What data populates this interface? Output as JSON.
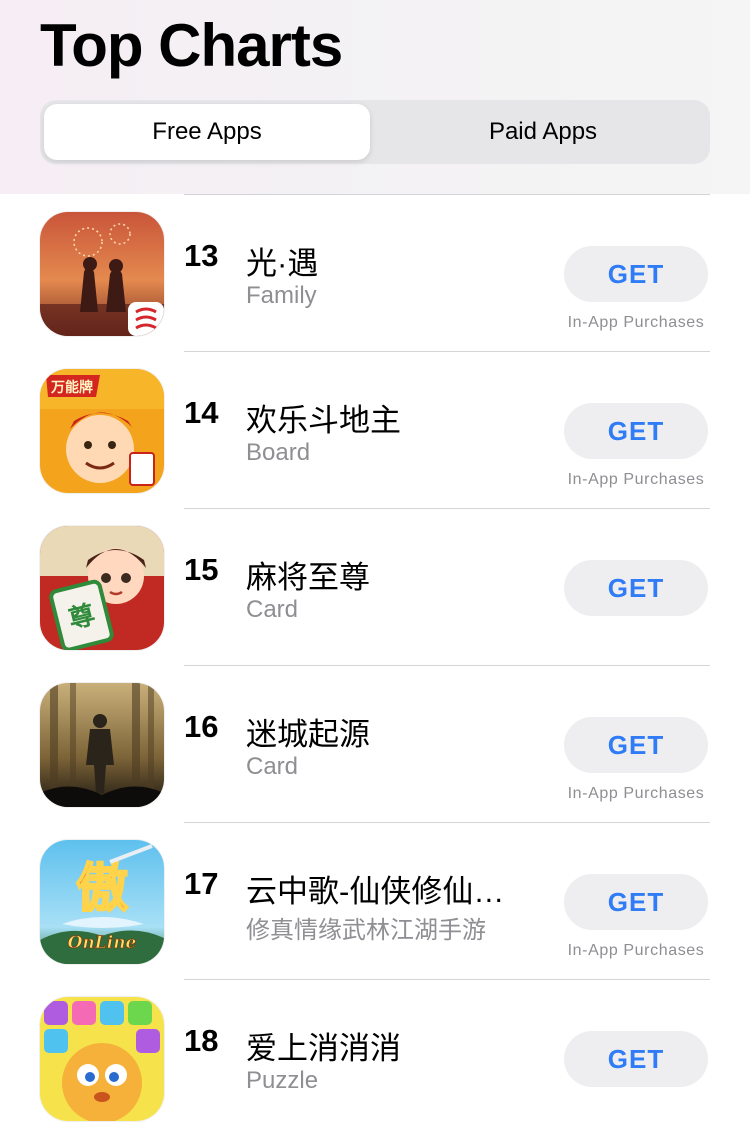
{
  "header": {
    "title": "Top Charts",
    "tabs": [
      {
        "label": "Free Apps",
        "selected": true
      },
      {
        "label": "Paid Apps",
        "selected": false
      }
    ]
  },
  "colors": {
    "accent": "#2f7cf6",
    "secondary_text": "#8e8e93",
    "button_bg": "#eeeef0"
  },
  "apps": [
    {
      "rank": "13",
      "name": "光·遇",
      "category": "Family",
      "button": "GET",
      "note": "In-App Purchases",
      "icon": "sky-children-of-light-icon"
    },
    {
      "rank": "14",
      "name": "欢乐斗地主",
      "category": "Board",
      "button": "GET",
      "note": "In-App Purchases",
      "icon": "happy-landlord-icon"
    },
    {
      "rank": "15",
      "name": "麻将至尊",
      "category": "Card",
      "button": "GET",
      "note": "",
      "icon": "mahjong-supreme-icon"
    },
    {
      "rank": "16",
      "name": "迷城起源",
      "category": "Card",
      "button": "GET",
      "note": "In-App Purchases",
      "icon": "lost-city-origin-icon"
    },
    {
      "rank": "17",
      "name": "云中歌-仙侠修仙…",
      "category": "修真情缘武林江湖手游",
      "button": "GET",
      "note": "In-App Purchases",
      "icon": "yunzhongge-online-icon"
    },
    {
      "rank": "18",
      "name": "爱上消消消",
      "category": "Puzzle",
      "button": "GET",
      "note": "",
      "icon": "love-match-puzzle-icon"
    }
  ]
}
